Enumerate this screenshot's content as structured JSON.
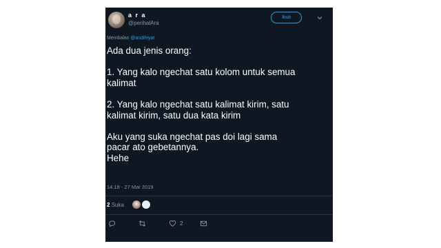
{
  "tweet": {
    "display_name": "a r a",
    "handle": "@perihalAra",
    "follow_label": "Ikuti",
    "reply_prefix": "Membalas",
    "reply_mention": "@andihiyat",
    "body": {
      "line1": "Ada dua jenis orang:",
      "line2": "1. Yang kalo ngechat satu kolom untuk semua",
      "line3": "kalimat",
      "line4": "2. Yang kalo ngechat satu kalimat kirim, satu",
      "line5": "kalimat kirim, satu dua kata kirim",
      "line6": "Aku yang suka ngechat pas doi lagi sama",
      "line7": "pacar ato gebetannya.",
      "line8": "Hehe"
    },
    "timestamp": "14.18 - 27 Mar 2019",
    "likes_number": "2",
    "likes_label": "Suka",
    "like_action_count": "2"
  },
  "icons": [
    "chevron-down-icon",
    "reply-icon",
    "retweet-icon",
    "heart-icon",
    "mail-icon"
  ],
  "colors": {
    "background": "#0f1722",
    "accent": "#1da1f2",
    "muted": "#8899a6"
  }
}
